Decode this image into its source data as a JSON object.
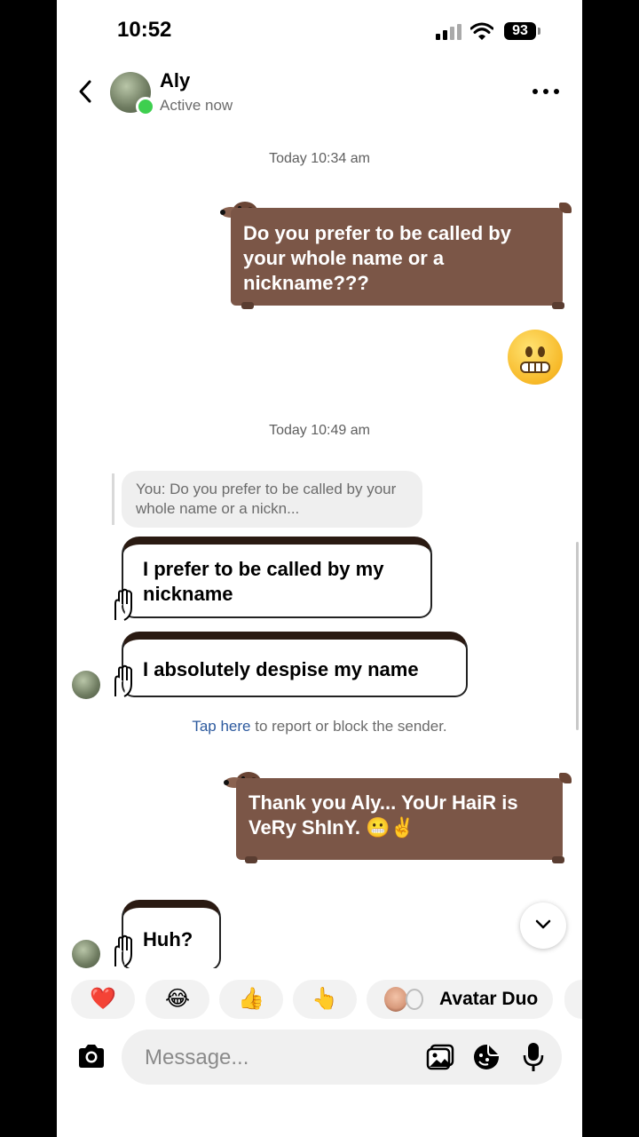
{
  "status_bar": {
    "time": "10:52",
    "battery": "93"
  },
  "header": {
    "name": "Aly",
    "status": "Active now"
  },
  "messages": {
    "timestamp_1": "Today 10:34 am",
    "outgoing_1": "Do you prefer to be called by your whole name or a nickname???",
    "emoji_1": "grimacing-face",
    "timestamp_2": "Today 10:49 am",
    "reply_preview": "You: Do you prefer to be called by your whole name or a nickn...",
    "incoming_1": "I prefer to be called by my nickname",
    "incoming_2": "I absolutely despise my name",
    "report_link": "Tap here",
    "report_text": " to report or block the sender.",
    "outgoing_2": "Thank you Aly... YoUr HaiR is VeRy ShInY. 😬✌️",
    "incoming_3": "Huh?"
  },
  "quick_reactions": {
    "heart": "❤️",
    "laugh": "😂",
    "thumbs": "👍",
    "point": "👆",
    "avatar_duo": "Avatar Duo"
  },
  "composer": {
    "placeholder": "Message..."
  },
  "colors": {
    "outgoing_bubble": "#7b5647",
    "online": "#3ecf4f",
    "link": "#2d5a9e"
  },
  "icons": [
    "back-icon",
    "more-icon",
    "camera-icon",
    "gallery-icon",
    "sticker-icon",
    "microphone-icon",
    "chevron-down-icon"
  ]
}
